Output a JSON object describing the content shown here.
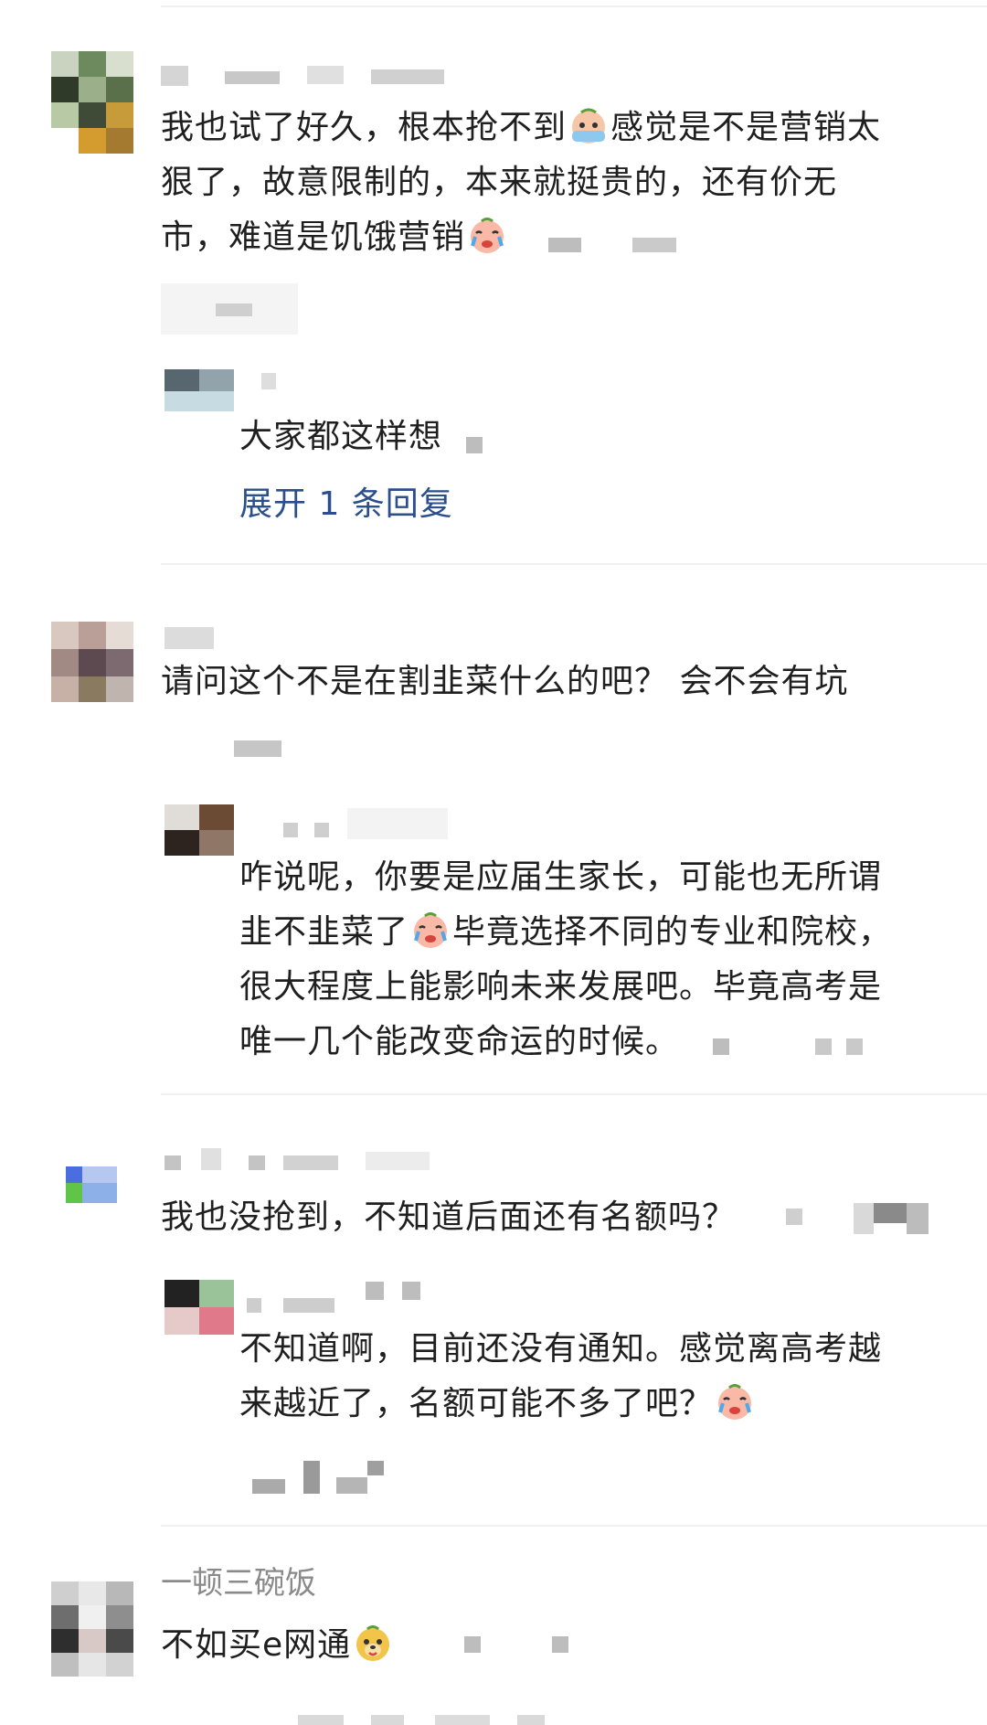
{
  "comments": [
    {
      "text_parts": [
        "我也试了好久，根本抢不到",
        "感觉是不是营销太",
        "狠了，故意限制的，本来就挺贵的，还有价无",
        "市，难道是饥饿营销"
      ],
      "reply": {
        "text": "大家都这样想",
        "expand_label": "展开 1 条回复"
      }
    },
    {
      "text": "请问这个不是在割韭菜什么的吧？ 会不会有坑",
      "reply": {
        "lines": [
          "咋说呢，你要是应届生家长，可能也无所谓",
          "韭不韭菜了",
          "毕竟选择不同的专业和院校，",
          "很大程度上能影响未来发展吧。毕竟高考是",
          "唯一几个能改变命运的时候。"
        ]
      }
    },
    {
      "text": "我也没抢到，不知道后面还有名额吗？",
      "reply": {
        "lines": [
          "不知道啊，目前还没有通知。感觉离高考越",
          "来越近了，名额可能不多了吧？"
        ]
      }
    },
    {
      "username": "一顿三碗饭",
      "text": "不如买e网通"
    }
  ],
  "icons": {
    "emoji_1": "crying-emoji-icon",
    "emoji_2": "sad-tears-emoji-icon",
    "emoji_3": "dog-face-emoji-icon"
  },
  "colors": {
    "link": "#2b4e8c",
    "username": "#8a8a8a",
    "text": "#1f1f1f",
    "divider": "#f0f0f0"
  }
}
